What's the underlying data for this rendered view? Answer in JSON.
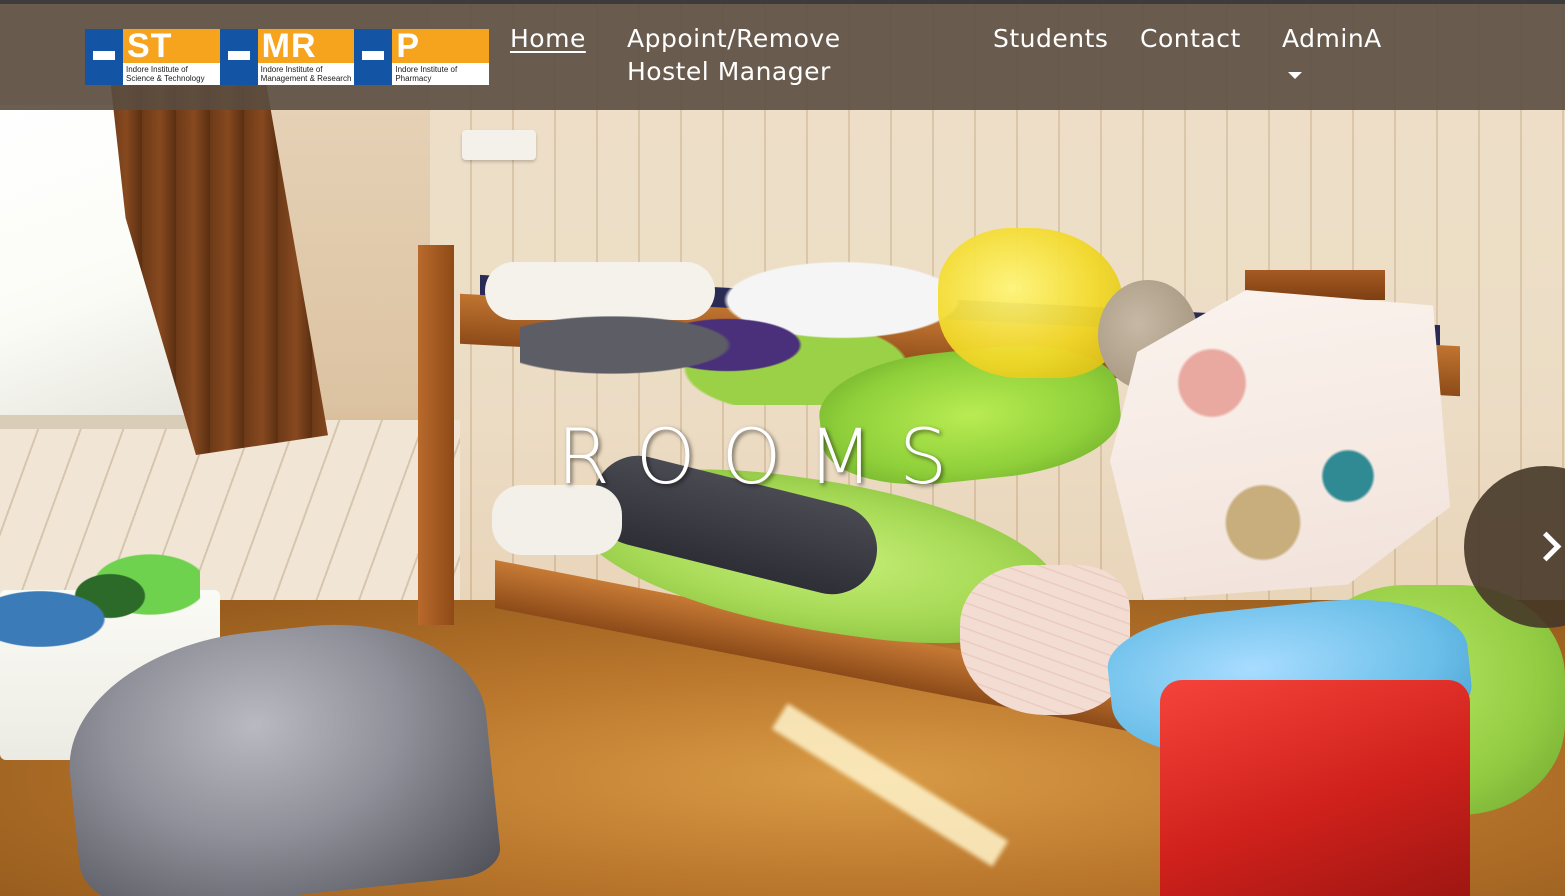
{
  "logo": {
    "blocks": [
      {
        "letters": "ST",
        "caption": "Indore Institute of\nScience & Technology"
      },
      {
        "letters": "MR",
        "caption": "Indore Institute of\nManagement & Research"
      },
      {
        "letters": "P",
        "caption": "Indore Institute of\nPharmacy"
      }
    ],
    "colors": {
      "blue": "#1355a4",
      "orange": "#f6a41e"
    }
  },
  "nav": {
    "items": [
      {
        "label": "Home",
        "active": true
      },
      {
        "label": "Appoint/Remove Hostel Manager",
        "active": false
      },
      {
        "label": "Students",
        "active": false
      },
      {
        "label": "Contact",
        "active": false
      },
      {
        "label": "AdminA",
        "active": false,
        "has_dropdown": true
      }
    ]
  },
  "hero": {
    "title": "ROOMS",
    "image": "hostel room with bunk beds"
  },
  "carousel": {
    "next_icon": "chevron-right-icon"
  },
  "colors": {
    "navbar_bg": "#5a4c40",
    "nav_text": "#ffffff"
  }
}
